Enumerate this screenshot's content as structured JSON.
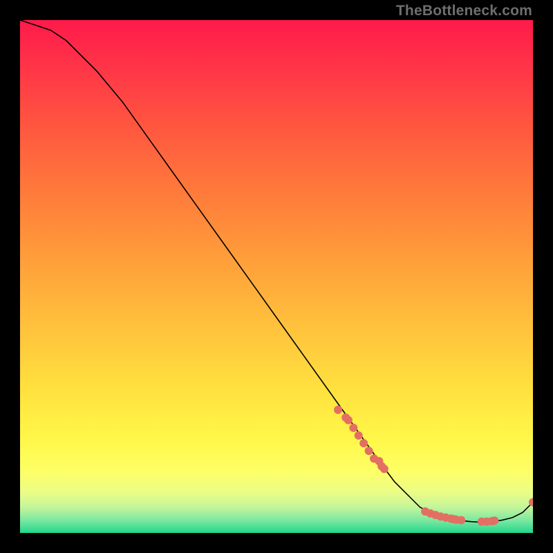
{
  "watermark": "TheBottleneck.com",
  "chart_data": {
    "type": "line",
    "title": "",
    "xlabel": "",
    "ylabel": "",
    "xlim": [
      0,
      100
    ],
    "ylim": [
      0,
      100
    ],
    "grid": false,
    "series": [
      {
        "name": "curve",
        "color": "#000000",
        "x": [
          0,
          3,
          6,
          9,
          12,
          15,
          20,
          25,
          30,
          35,
          40,
          45,
          50,
          55,
          60,
          65,
          70,
          73,
          75,
          78,
          80,
          83,
          85,
          88,
          90,
          92,
          94,
          96,
          98,
          100
        ],
        "y": [
          100,
          99,
          98,
          96,
          93,
          90,
          84,
          77,
          70,
          63,
          56,
          49,
          42,
          35,
          28,
          21,
          14,
          10,
          8,
          5,
          4,
          3,
          2.5,
          2.2,
          2.1,
          2.2,
          2.5,
          3,
          4,
          6
        ]
      }
    ],
    "markers": {
      "name": "points",
      "color": "#e36f63",
      "radius": 6,
      "x": [
        62,
        63.5,
        64,
        65,
        66,
        67,
        68,
        69,
        70,
        70.5,
        71,
        79,
        80,
        81,
        82,
        83,
        84,
        84.5,
        85,
        86,
        90,
        91,
        92,
        92.5,
        100
      ],
      "y": [
        24,
        22.5,
        22,
        20.5,
        19,
        17.5,
        16,
        14.5,
        14,
        13,
        12.5,
        4.2,
        3.8,
        3.5,
        3.2,
        3.0,
        2.8,
        2.7,
        2.6,
        2.5,
        2.2,
        2.2,
        2.3,
        2.4,
        6
      ]
    },
    "background_gradient": {
      "type": "vertical",
      "stops": [
        {
          "pos": 0.0,
          "color": "#ff1a4b"
        },
        {
          "pos": 0.1,
          "color": "#ff3747"
        },
        {
          "pos": 0.22,
          "color": "#ff5a3f"
        },
        {
          "pos": 0.35,
          "color": "#ff7e3a"
        },
        {
          "pos": 0.48,
          "color": "#ffa23a"
        },
        {
          "pos": 0.6,
          "color": "#ffc23c"
        },
        {
          "pos": 0.72,
          "color": "#ffe13e"
        },
        {
          "pos": 0.82,
          "color": "#fff84a"
        },
        {
          "pos": 0.88,
          "color": "#fdff66"
        },
        {
          "pos": 0.92,
          "color": "#ecfd86"
        },
        {
          "pos": 0.95,
          "color": "#c4f59a"
        },
        {
          "pos": 0.975,
          "color": "#7de8a0"
        },
        {
          "pos": 1.0,
          "color": "#22d78f"
        }
      ]
    }
  }
}
